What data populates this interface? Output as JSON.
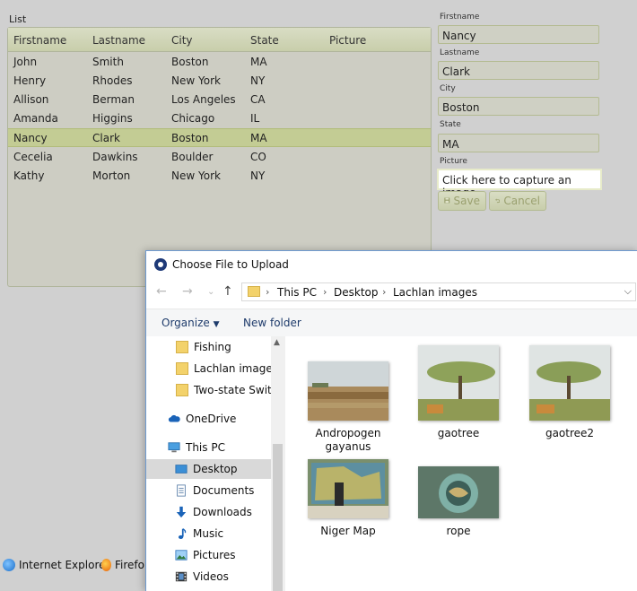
{
  "list": {
    "title": "List",
    "columns": [
      "Firstname",
      "Lastname",
      "City",
      "State",
      "Picture"
    ],
    "rows": [
      {
        "first": "John",
        "last": "Smith",
        "city": "Boston",
        "state": "MA"
      },
      {
        "first": "Henry",
        "last": "Rhodes",
        "city": "New York",
        "state": "NY"
      },
      {
        "first": "Allison",
        "last": "Berman",
        "city": "Los Angeles",
        "state": "CA"
      },
      {
        "first": "Amanda",
        "last": "Higgins",
        "city": "Chicago",
        "state": "IL"
      },
      {
        "first": "Nancy",
        "last": "Clark",
        "city": "Boston",
        "state": "MA"
      },
      {
        "first": "Cecelia",
        "last": "Dawkins",
        "city": "Boulder",
        "state": "CO"
      },
      {
        "first": "Kathy",
        "last": "Morton",
        "city": "New York",
        "state": "NY"
      }
    ],
    "selected_row": "Nancy"
  },
  "form": {
    "firstname_label": "Firstname",
    "firstname_value": "Nancy",
    "lastname_label": "Lastname",
    "lastname_value": "Clark",
    "city_label": "City",
    "city_value": "Boston",
    "state_label": "State",
    "state_value": "MA",
    "picture_label": "Picture",
    "capture_text": "Click here to capture an image.",
    "save_label": "Save",
    "cancel_label": "Cancel"
  },
  "taskbar": {
    "ie_label": "Internet Explorer",
    "ff_label": "Firefo"
  },
  "dialog": {
    "title": "Choose File to Upload",
    "breadcrumb": [
      "This PC",
      "Desktop",
      "Lachlan images"
    ],
    "organize_label": "Organize",
    "new_folder_label": "New folder",
    "nav_items": [
      {
        "label": "Fishing",
        "icon": "folder-icon"
      },
      {
        "label": "Lachlan images",
        "icon": "folder-icon"
      },
      {
        "label": "Two-state Switch",
        "icon": "folder-check-icon"
      },
      {
        "label": "OneDrive",
        "icon": "cloud-icon"
      },
      {
        "label": "This PC",
        "icon": "computer-icon"
      },
      {
        "label": "Desktop",
        "icon": "desktop-icon"
      },
      {
        "label": "Documents",
        "icon": "documents-icon"
      },
      {
        "label": "Downloads",
        "icon": "downloads-icon"
      },
      {
        "label": "Music",
        "icon": "music-icon"
      },
      {
        "label": "Pictures",
        "icon": "pictures-icon"
      },
      {
        "label": "Videos",
        "icon": "videos-icon"
      }
    ],
    "selected_nav": "Desktop",
    "files": [
      {
        "name": "Andropogen gayanus"
      },
      {
        "name": "gaotree"
      },
      {
        "name": "gaotree2"
      },
      {
        "name": "Niger Map"
      },
      {
        "name": "rope"
      }
    ]
  },
  "colors": {
    "selection_green": "#c3cc94",
    "dialog_border": "#6e9ad0",
    "nav_selected": "#d9d9d9"
  }
}
